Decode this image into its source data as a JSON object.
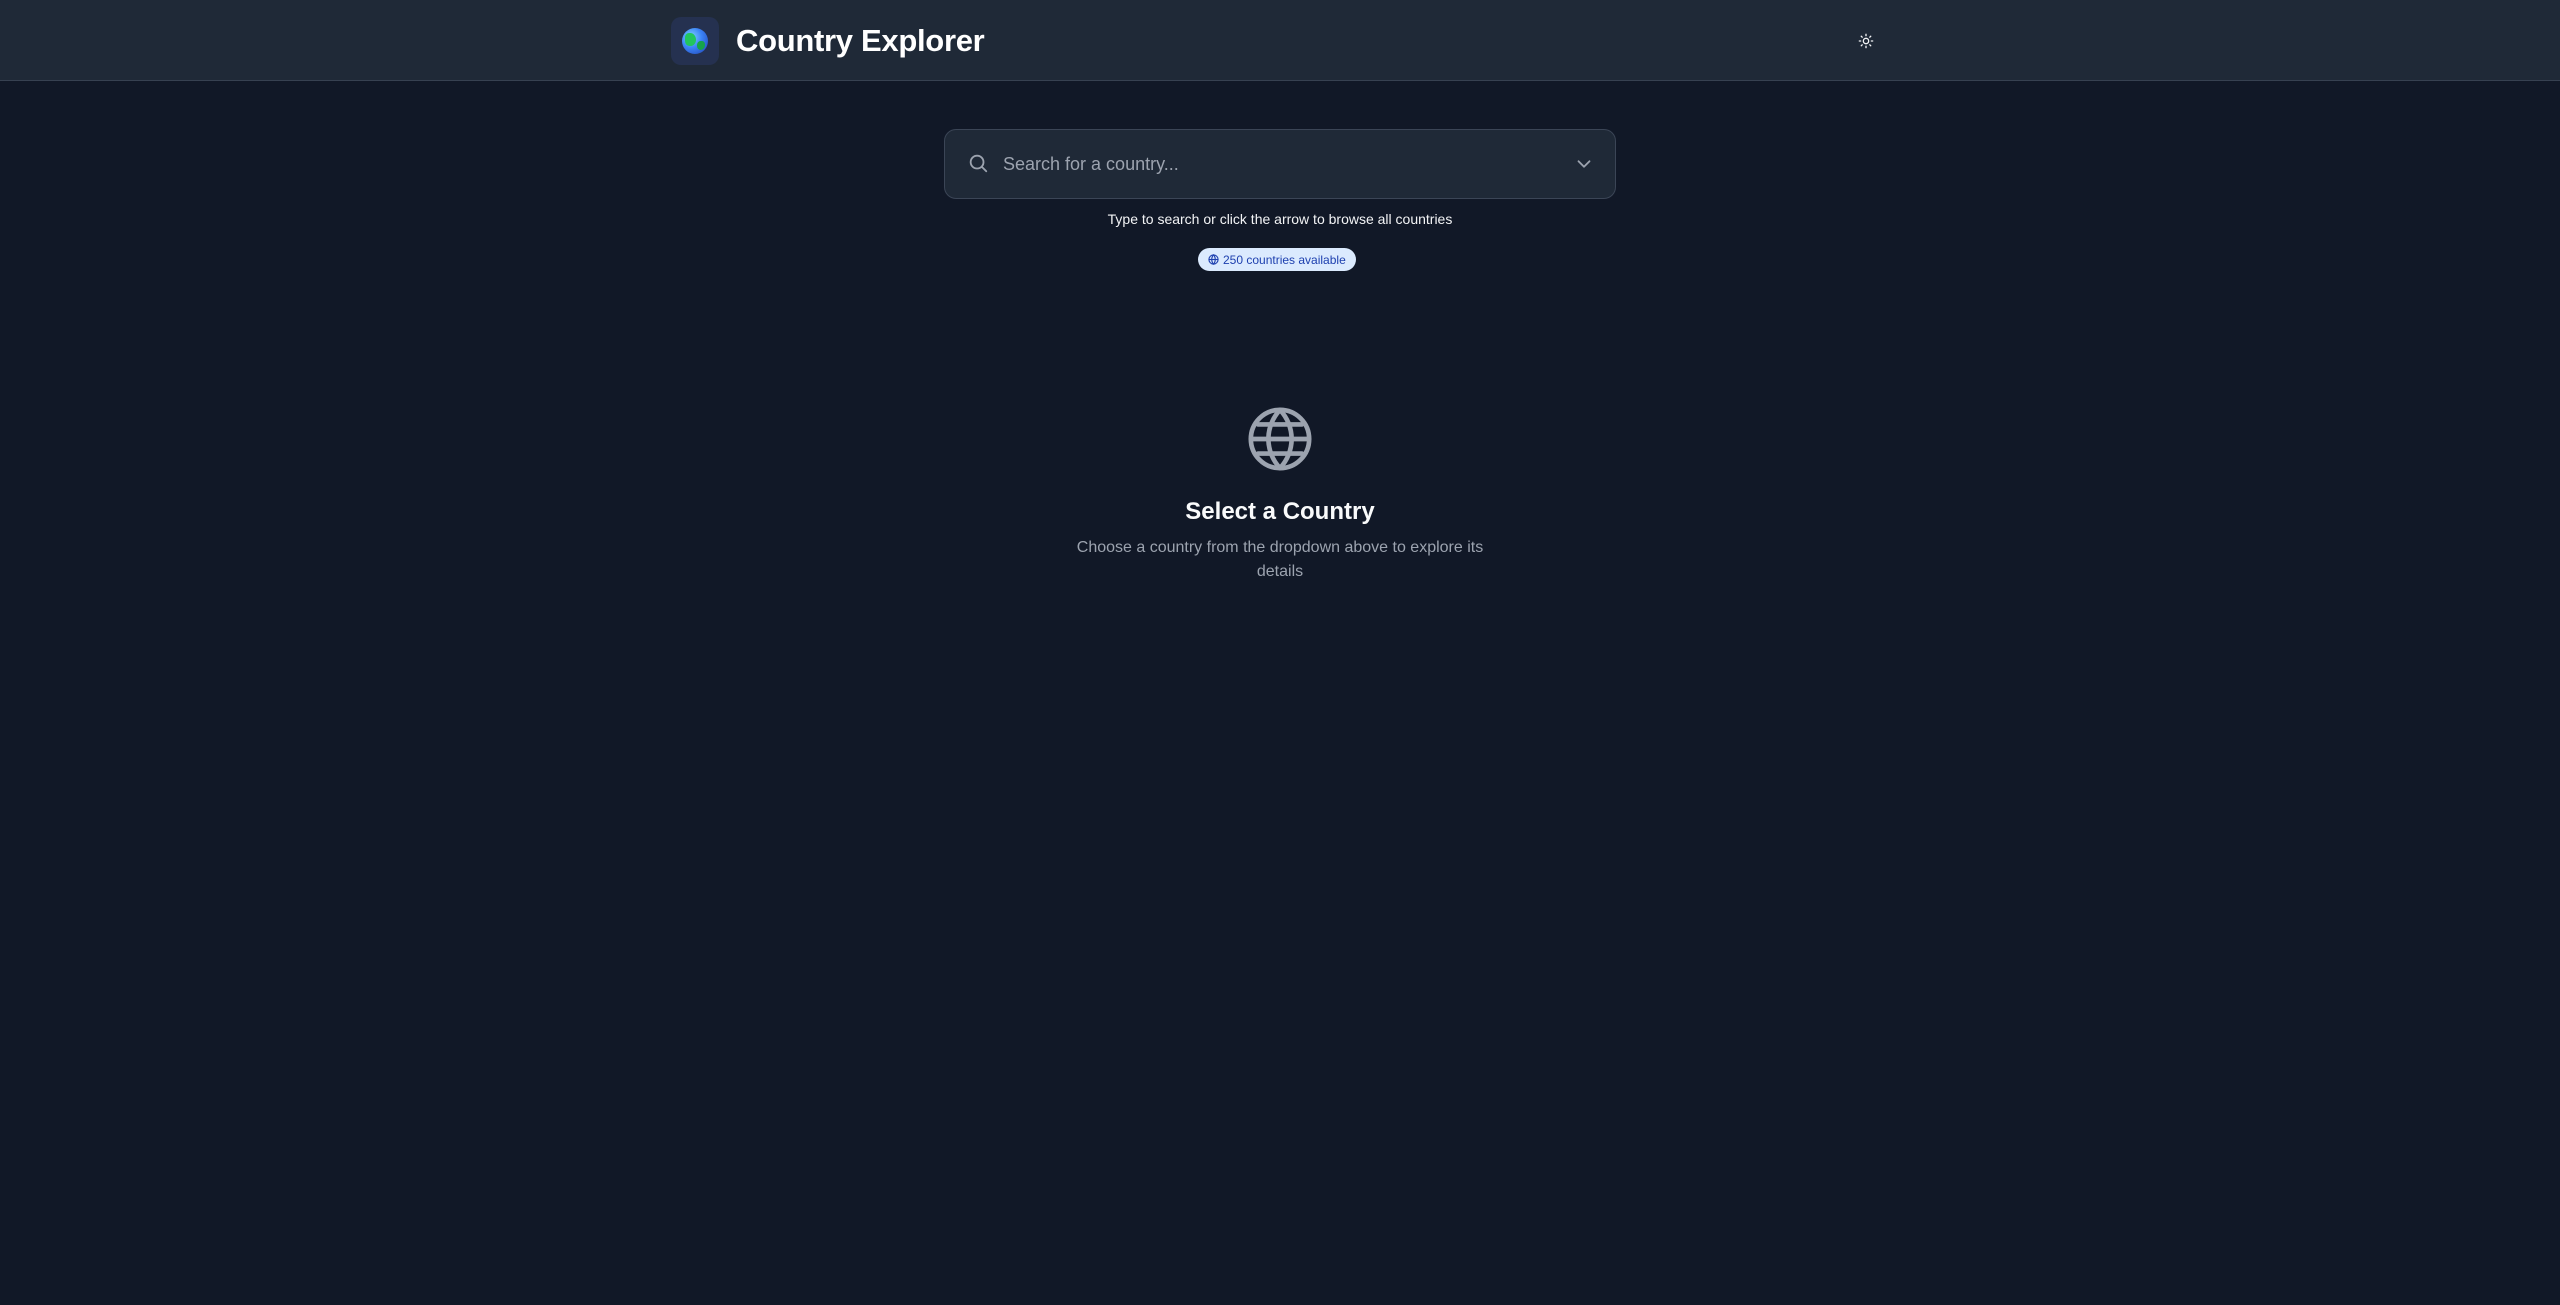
{
  "header": {
    "title": "Country Explorer",
    "logo_icon": "globe-emoji-icon",
    "theme_toggle_icon": "sun-icon"
  },
  "search": {
    "placeholder": "Search for a country...",
    "value": "",
    "left_icon": "search-icon",
    "right_icon": "chevron-down-icon"
  },
  "hint": "Type to search or click the arrow to browse all countries",
  "badge": {
    "text": "250 countries available",
    "icon": "globe-icon"
  },
  "empty_state": {
    "icon": "globe-icon",
    "title": "Select a Country",
    "description": "Choose a country from the dropdown above to explore its details"
  },
  "colors": {
    "background": "#111827",
    "header_bg": "#1f2937",
    "badge_bg": "#dbeafe",
    "badge_text": "#1e40af",
    "muted_text": "#9ca3af"
  }
}
